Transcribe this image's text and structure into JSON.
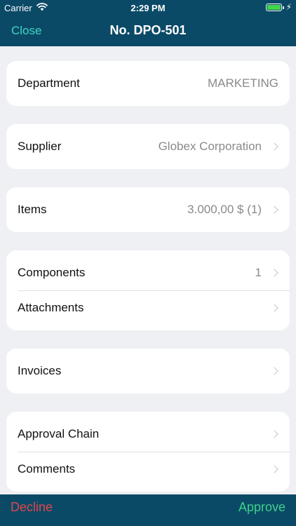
{
  "status_bar": {
    "carrier": "Carrier",
    "time": "2:29 PM",
    "wifi_icon": "wifi-icon",
    "battery_icon": "battery-icon",
    "charging_icon": "bolt-icon"
  },
  "nav": {
    "close_label": "Close",
    "title": "No. DPO-501"
  },
  "sections": {
    "department": {
      "label": "Department",
      "value": "MARKETING"
    },
    "supplier": {
      "label": "Supplier",
      "value": "Globex Corporation"
    },
    "items": {
      "label": "Items",
      "value": "3.000,00 $ (1)"
    },
    "components": {
      "label": "Components",
      "value": "1"
    },
    "attachments": {
      "label": "Attachments"
    },
    "invoices": {
      "label": "Invoices"
    },
    "approval_chain": {
      "label": "Approval Chain"
    },
    "comments": {
      "label": "Comments"
    }
  },
  "actions": {
    "decline_label": "Decline",
    "approve_label": "Approve"
  },
  "colors": {
    "bar_background": "#0b4a67",
    "close_accent": "#3fd4c4",
    "decline": "#e0454a",
    "approve": "#3ed08a",
    "page_background": "#eef0f3"
  }
}
